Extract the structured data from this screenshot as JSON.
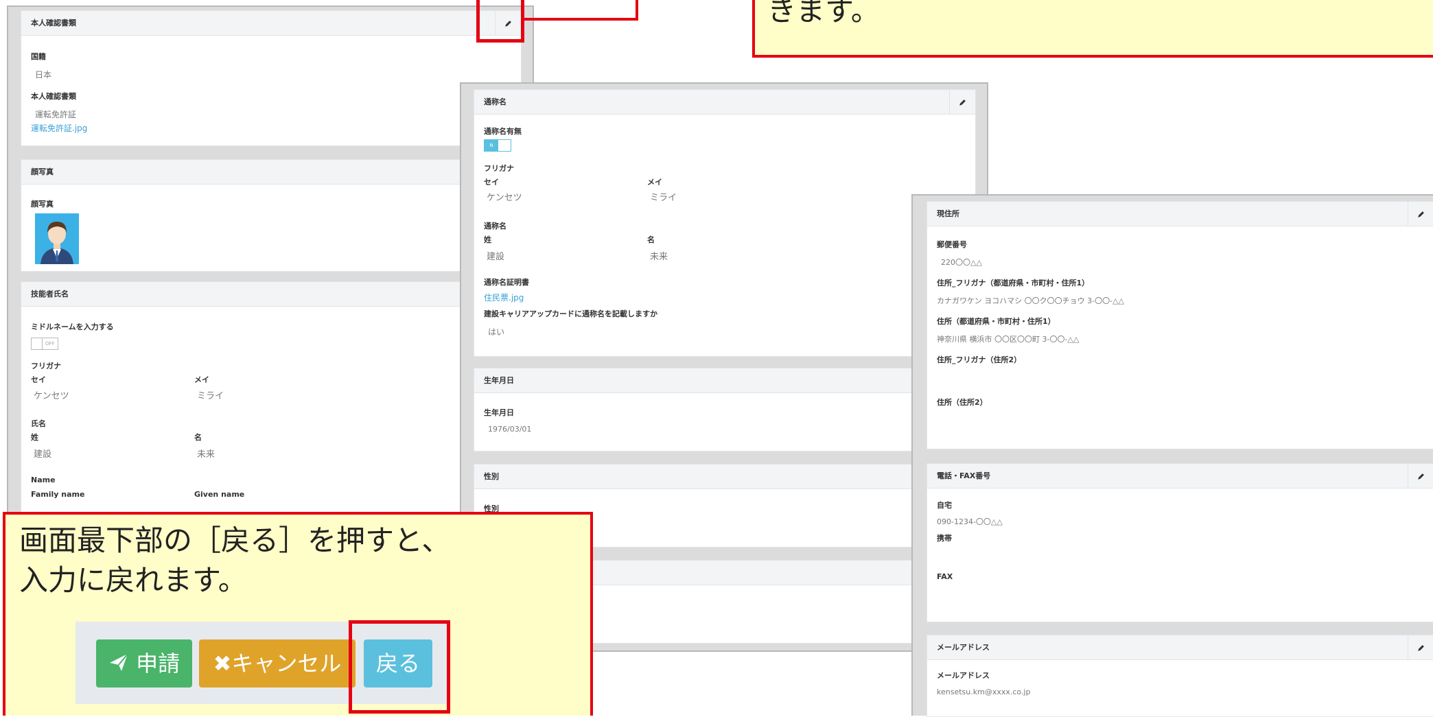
{
  "left": {
    "id_docs": {
      "title": "本人確認書類",
      "nationality_label": "国籍",
      "nationality_value": "日本",
      "doc_label": "本人確認書類",
      "doc_value": "運転免許証",
      "doc_file": "運転免許証.jpg"
    },
    "face": {
      "title": "顔写真",
      "label": "顔写真"
    },
    "name": {
      "title": "技能者氏名",
      "middle_label": "ミドルネームを入力する",
      "toggle_off": "OFF",
      "furigana": "フリガナ",
      "sei": "セイ",
      "mei": "メイ",
      "sei_value": "ケンセツ",
      "mei_value": "ミライ",
      "shimei": "氏名",
      "sei_kanji": "姓",
      "mei_kanji": "名",
      "sei_kanji_value": "建設",
      "mei_kanji_value": "未来",
      "name_en": "Name",
      "family": "Family name",
      "given": "Given name"
    }
  },
  "middle": {
    "alias": {
      "title": "通称名",
      "has_label": "通称名有無",
      "toggle_on": "N",
      "furigana": "フリガナ",
      "sei": "セイ",
      "mei": "メイ",
      "sei_value": "ケンセツ",
      "mei_value": "ミライ",
      "alias_label": "通称名",
      "sei_kanji": "姓",
      "mei_kanji": "名",
      "sei_kanji_value": "建設",
      "mei_kanji_value": "未来",
      "cert_label": "通称名証明書",
      "cert_file": "住民票.jpg",
      "card_question": "建設キャリアアップカードに通称名を記載しますか",
      "card_answer": "はい"
    },
    "birth": {
      "title": "生年月日",
      "label": "生年月日",
      "value": "1976/03/01"
    },
    "gender": {
      "title": "性別",
      "label": "性別"
    }
  },
  "right": {
    "address": {
      "title": "現住所",
      "zip_label": "郵便番号",
      "zip_value": "220〇〇△△",
      "addr_kana_label": "住所_フリガナ（都道府県・市町村・住所1）",
      "addr_kana_value": "カナガワケン ヨコハマシ 〇〇ク〇〇チョウ 3-〇〇-△△",
      "addr_label": "住所（都道府県・市町村・住所1）",
      "addr_value": "神奈川県 横浜市 〇〇区〇〇町 3-〇〇-△△",
      "addr2_kana_label": "住所_フリガナ（住所2）",
      "addr2_label": "住所（住所2）"
    },
    "phone": {
      "title": "電話・FAX番号",
      "home_label": "自宅",
      "home_value": "090-1234-〇〇△△",
      "mobile_label": "携帯",
      "fax_label": "FAX"
    },
    "mail": {
      "title": "メールアドレス",
      "label": "メールアドレス",
      "value": "kensetsu.km@xxxx.co.jp"
    }
  },
  "top_callout": {
    "text": "きます。"
  },
  "bottom_callout": {
    "line1": "画面最下部の［戻る］を押すと、",
    "line2": "入力に戻れます。"
  },
  "buttons": {
    "apply": "申請",
    "cancel": "キャンセル",
    "back": "戻る"
  },
  "colors": {
    "accent_red": "#e60012",
    "callout_bg": "#fffdc8",
    "apply_green": "#49b46a",
    "cancel_amber": "#e0a32a",
    "back_blue": "#5bc0de",
    "link_blue": "#3aa0d8"
  }
}
